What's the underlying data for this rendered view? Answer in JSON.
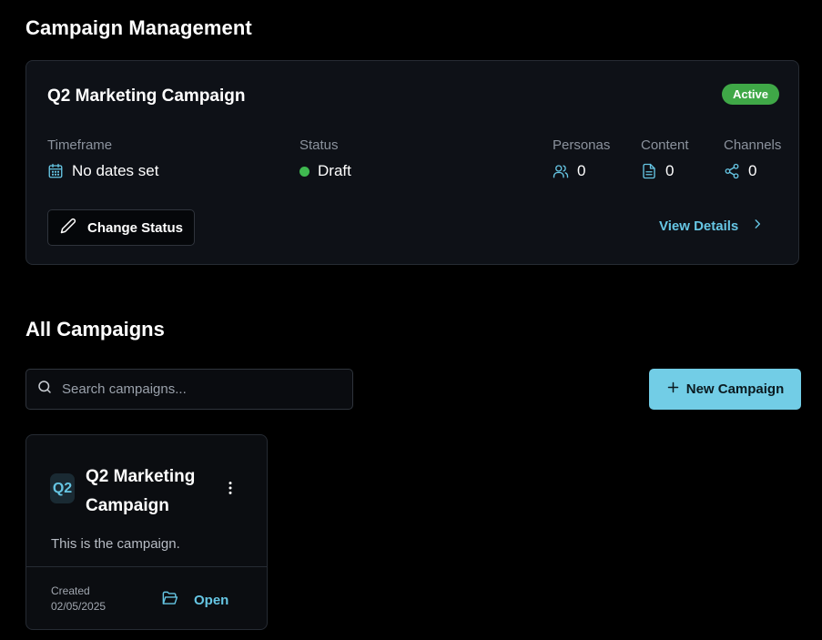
{
  "header": {
    "title": "Campaign Management"
  },
  "campaign_card": {
    "title": "Q2 Marketing Campaign",
    "badge": "Active",
    "timeframe": {
      "label": "Timeframe",
      "value": "No dates set"
    },
    "status": {
      "label": "Status",
      "value": "Draft"
    },
    "personas": {
      "label": "Personas",
      "value": "0"
    },
    "content": {
      "label": "Content",
      "value": "0"
    },
    "channels": {
      "label": "Channels",
      "value": "0"
    },
    "change_status_label": "Change Status",
    "view_details_label": "View Details"
  },
  "all_campaigns": {
    "title": "All Campaigns",
    "search_placeholder": "Search campaigns...",
    "new_campaign_label": "New Campaign",
    "items": [
      {
        "initials": "Q2",
        "title": "Q2 Marketing Campaign",
        "description": "This is the campaign.",
        "created_label": "Created",
        "created_date": "02/05/2025",
        "open_label": "Open"
      }
    ]
  },
  "colors": {
    "accent": "#66c6e4",
    "button_primary": "#72cde6",
    "active_badge": "#3fa847",
    "draft_dot": "#3fb950",
    "card_bg": "#0e1117"
  },
  "icons": {
    "timeframe": "calendar-icon",
    "personas": "users-icon",
    "content": "file-text-icon",
    "channels": "share-icon",
    "change_status": "pencil-icon",
    "view_details": "chevron-right-icon",
    "search": "search-icon",
    "new_campaign": "plus-icon",
    "tile_menu": "more-vertical-icon",
    "open": "folder-open-icon"
  }
}
